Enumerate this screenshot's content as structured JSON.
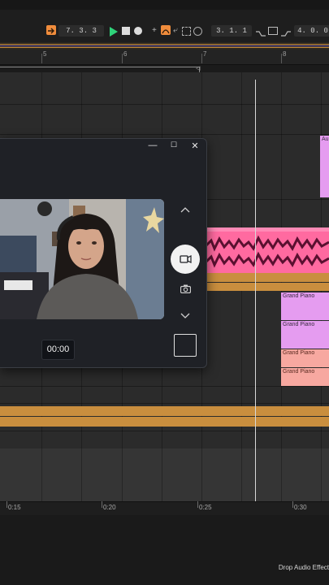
{
  "transport": {
    "position": "7. 3. 3",
    "loop_start": "3. 1. 1",
    "loop_length": "4. 0. 0"
  },
  "ruler": {
    "bars": [
      "5",
      "6",
      "7",
      "8"
    ]
  },
  "clips": {
    "audio_top": "Au",
    "grand_piano_1": "Grand Piano",
    "grand_piano_2": "Grand Piano",
    "grand_piano_3": "Grand Piano",
    "grand_piano_4": "Grand Piano"
  },
  "time_ruler": {
    "labels": [
      "0:15",
      "0:20",
      "0:25",
      "0:30"
    ]
  },
  "camera": {
    "timer": "00:00",
    "minimize_glyph": "—",
    "maximize_glyph": "☐",
    "close_glyph": "✕"
  },
  "status": {
    "drop_hint": "Drop Audio Effect"
  },
  "colors": {
    "orange": "#f08c3c",
    "pink": "#ff6aa0",
    "violet": "#e59cf0",
    "tan": "#c98e3e",
    "salmon": "#f7a8a0"
  }
}
